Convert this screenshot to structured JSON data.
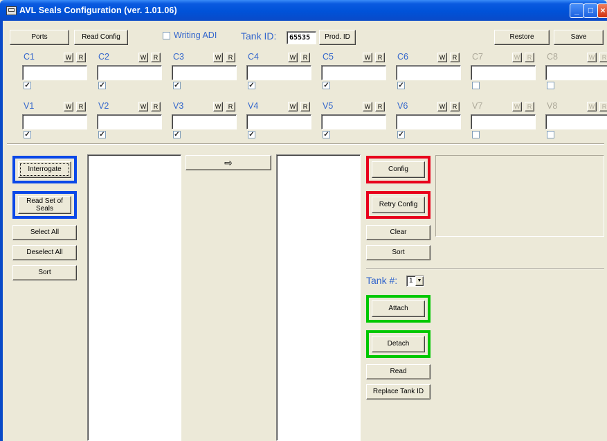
{
  "window": {
    "title": "AVL Seals Configuration (ver. 1.01.06)"
  },
  "toolbar": {
    "ports_label": "Ports",
    "read_config_label": "Read Config",
    "writing_adi_label": "Writing ADI",
    "tank_id_label": "Tank ID:",
    "tank_id_value": "65535",
    "prod_id_label": "Prod. ID",
    "restore_label": "Restore",
    "save_label": "Save"
  },
  "channels_c": [
    {
      "name": "C1",
      "enabled": true,
      "checked": true
    },
    {
      "name": "C2",
      "enabled": true,
      "checked": true
    },
    {
      "name": "C3",
      "enabled": true,
      "checked": true
    },
    {
      "name": "C4",
      "enabled": true,
      "checked": true
    },
    {
      "name": "C5",
      "enabled": true,
      "checked": true
    },
    {
      "name": "C6",
      "enabled": true,
      "checked": true
    },
    {
      "name": "C7",
      "enabled": false,
      "checked": false
    },
    {
      "name": "C8",
      "enabled": false,
      "checked": false
    }
  ],
  "channels_v": [
    {
      "name": "V1",
      "enabled": true,
      "checked": true
    },
    {
      "name": "V2",
      "enabled": true,
      "checked": true
    },
    {
      "name": "V3",
      "enabled": true,
      "checked": true
    },
    {
      "name": "V4",
      "enabled": true,
      "checked": true
    },
    {
      "name": "V5",
      "enabled": true,
      "checked": true
    },
    {
      "name": "V6",
      "enabled": true,
      "checked": true
    },
    {
      "name": "V7",
      "enabled": false,
      "checked": false
    },
    {
      "name": "V8",
      "enabled": false,
      "checked": false
    }
  ],
  "wr": {
    "w": "W",
    "r": "R"
  },
  "left_panel": {
    "interrogate_label": "Interrogate",
    "read_set_label": "Read Set of Seals",
    "select_all_label": "Select All",
    "deselect_all_label": "Deselect All",
    "sort_label": "Sort"
  },
  "transfer": {
    "arrow": "⇨"
  },
  "right_panel": {
    "config_label": "Config",
    "retry_config_label": "Retry Config",
    "clear_label": "Clear",
    "sort_label": "Sort",
    "tank_num_label": "Tank #:",
    "tank_num_value": "1",
    "attach_label": "Attach",
    "detach_label": "Detach",
    "read_label": "Read",
    "replace_tank_id_label": "Replace Tank ID"
  },
  "colors": {
    "highlight_blue": "#0a48e8",
    "highlight_red": "#e8001c",
    "highlight_green": "#00c800",
    "label_blue": "#3366cc"
  },
  "icons": [
    "window-app-icon",
    "minimize-icon",
    "maximize-icon",
    "close-icon",
    "arrow-right-icon",
    "checkbox-icon",
    "dropdown-arrow-icon"
  ]
}
